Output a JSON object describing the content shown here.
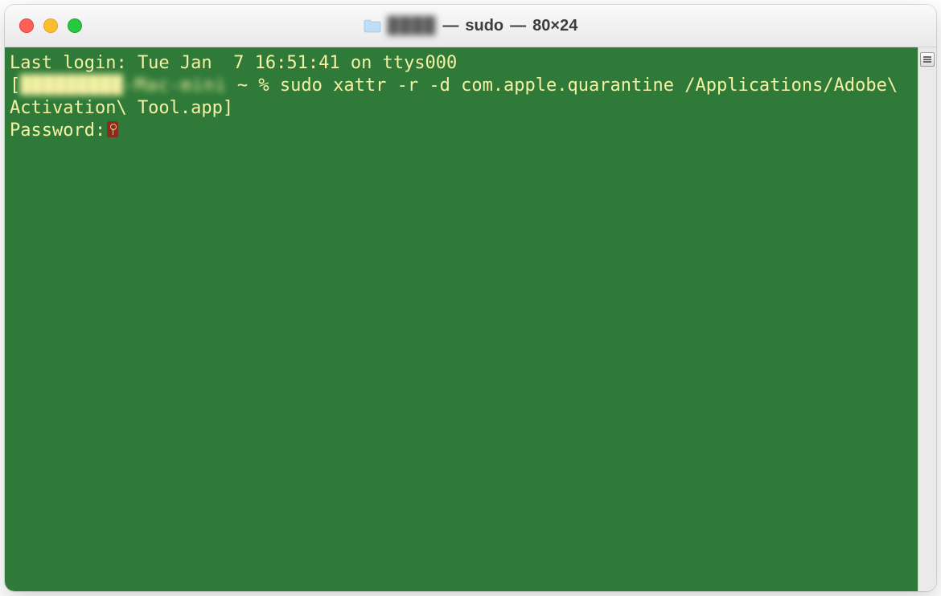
{
  "window": {
    "title_folder_name": "████",
    "title_process": "sudo",
    "title_dims": "80×24",
    "title_sep": " — "
  },
  "terminal": {
    "last_login": "Last login: Tue Jan  7 16:51:41 on ttys000",
    "prompt_host_masked": "█████████-Mac-mini",
    "prompt_path": " ~ % ",
    "command": "sudo xattr -r -d com.apple.quarantine /Applications/Adobe\\ Activation\\ Tool.app",
    "password_label": "Password:",
    "bracket_open": "[",
    "bracket_close": "]"
  },
  "colors": {
    "terminal_bg": "#2f7a39",
    "terminal_fg": "#f5f1a4"
  }
}
